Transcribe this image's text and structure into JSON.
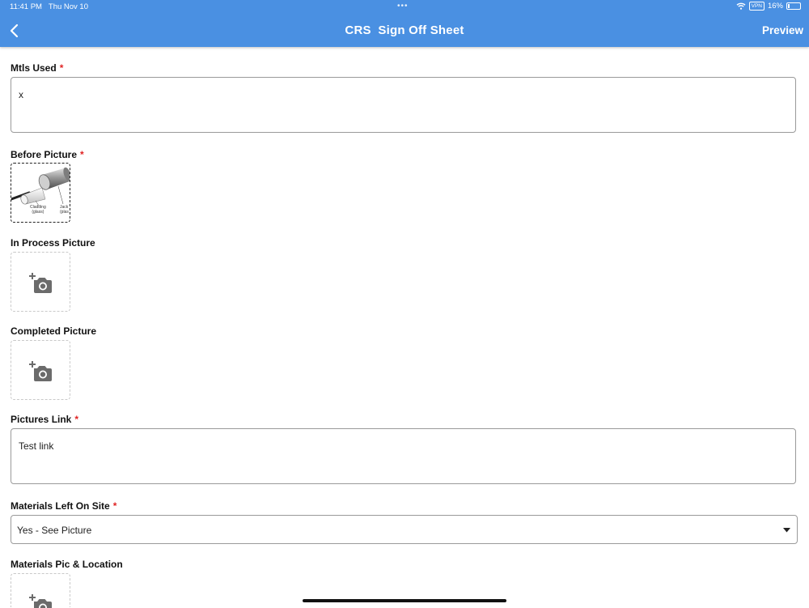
{
  "status_bar": {
    "time": "11:41 PM",
    "date": "Thu Nov 10",
    "vpn": "VPN",
    "battery": "16%",
    "battery_level": 0.16
  },
  "header": {
    "title": "CRS  Sign Off Sheet",
    "preview_label": "Preview",
    "back_icon": "chevron-left-icon"
  },
  "form": {
    "mtls_used": {
      "label": "Mtls Used",
      "required_mark": "*",
      "value": "x"
    },
    "before_picture": {
      "label": "Before Picture",
      "required_mark": "*",
      "caption_left": "Cladding\n(glass)",
      "caption_right": "Jack\n(plas"
    },
    "in_process_picture": {
      "label": "In Process Picture",
      "icon": "add-photo-icon"
    },
    "completed_picture": {
      "label": "Completed Picture",
      "icon": "add-photo-icon"
    },
    "pictures_link": {
      "label": "Pictures Link",
      "required_mark": "*",
      "value": "Test link"
    },
    "materials_left_on_site": {
      "label": "Materials Left On Site",
      "required_mark": "*",
      "selected": "Yes - See Picture"
    },
    "materials_pic_location": {
      "label": "Materials Pic & Location",
      "icon": "add-photo-icon"
    }
  }
}
